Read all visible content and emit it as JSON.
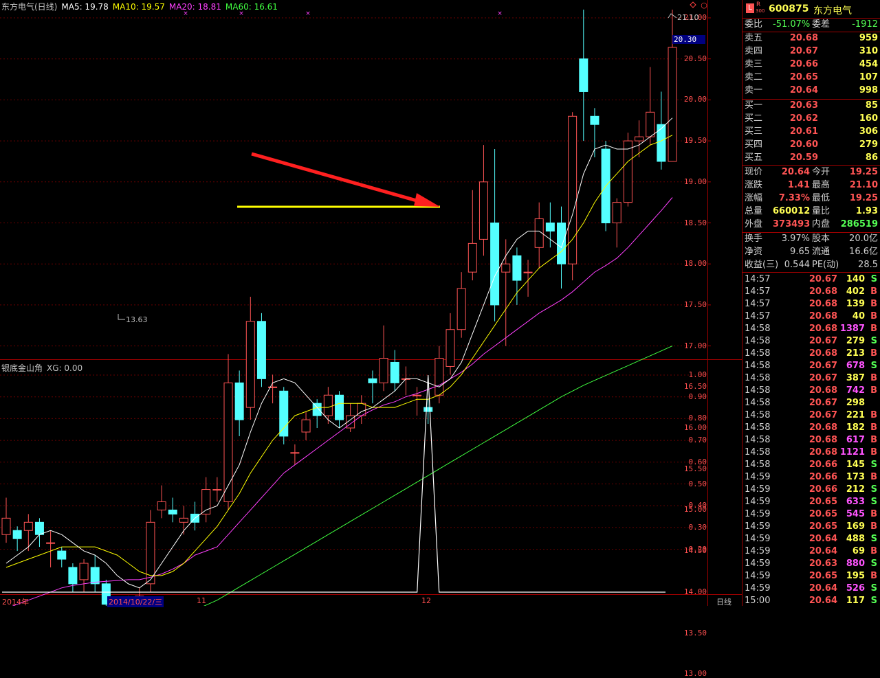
{
  "legend": {
    "title": "东方电气(日线)",
    "ma5": "MA5: 19.78",
    "ma10": "MA10: 19.57",
    "ma20": "MA20: 18.81",
    "ma60": "MA60: 16.61",
    "colors": {
      "ma5": "#ffffff",
      "ma10": "#ffff00",
      "ma20": "#ff40ff",
      "ma60": "#40ff40",
      "up": "#ff5454",
      "down": "#54ffff"
    }
  },
  "indicator": {
    "name": "银底金山角",
    "xg": "XG: 0.00"
  },
  "price_axis": [
    "21.00",
    "20.50",
    "20.00",
    "19.50",
    "19.00",
    "18.50",
    "18.00",
    "17.50",
    "17.00",
    "16.50",
    "16.00",
    "15.50",
    "15.00",
    "14.50",
    "14.00",
    "13.50",
    "13.00"
  ],
  "current_price_tag": "20.30",
  "indicator_axis": [
    "1.00",
    "0.90",
    "0.80",
    "0.70",
    "0.60",
    "0.50",
    "0.40",
    "0.30",
    "0.20"
  ],
  "annotations": {
    "high_label": "21.10",
    "low_label": "13.63"
  },
  "x_axis": {
    "year": "2014年",
    "selected_date": "2014/10/22/三",
    "month_11": "11",
    "month_12": "12",
    "period": "日线"
  },
  "chart_data": {
    "type": "candlestick",
    "title": "东方电气(日线)",
    "ylim": [
      12.7,
      21.15
    ],
    "candles": [
      [
        14.7,
        14.9,
        15.15,
        14.6
      ],
      [
        14.75,
        14.65,
        14.8,
        14.5
      ],
      [
        14.75,
        14.85,
        14.95,
        14.5
      ],
      [
        14.85,
        14.7,
        14.9,
        14.55
      ],
      [
        14.6,
        14.6,
        14.75,
        14.3
      ],
      [
        14.5,
        14.4,
        14.55,
        14.3
      ],
      [
        14.3,
        14.1,
        14.35,
        14.0
      ],
      [
        14.15,
        14.35,
        14.4,
        14.0
      ],
      [
        14.3,
        14.1,
        14.45,
        14.0
      ],
      [
        14.1,
        13.85,
        14.15,
        13.8
      ],
      [
        13.75,
        13.75,
        13.85,
        13.63
      ],
      [
        13.9,
        13.8,
        13.95,
        13.75
      ],
      [
        13.8,
        13.95,
        14.05,
        13.75
      ],
      [
        14.1,
        14.85,
        15.0,
        14.0
      ],
      [
        15.0,
        15.1,
        15.3,
        14.9
      ],
      [
        15.0,
        14.95,
        15.15,
        14.85
      ],
      [
        14.85,
        14.9,
        15.05,
        14.7
      ],
      [
        14.95,
        14.85,
        15.1,
        14.75
      ],
      [
        14.95,
        15.25,
        15.4,
        14.85
      ],
      [
        15.25,
        15.25,
        15.4,
        15.1
      ],
      [
        15.1,
        16.55,
        16.9,
        15.0
      ],
      [
        16.55,
        16.1,
        16.7,
        15.9
      ],
      [
        16.25,
        17.3,
        17.6,
        16.1
      ],
      [
        17.3,
        16.6,
        17.4,
        16.5
      ],
      [
        16.5,
        16.5,
        16.65,
        16.3
      ],
      [
        16.45,
        15.9,
        16.5,
        15.8
      ],
      [
        15.7,
        15.7,
        15.8,
        15.55
      ],
      [
        15.95,
        16.1,
        16.2,
        15.85
      ],
      [
        16.3,
        16.15,
        16.35,
        16.0
      ],
      [
        16.15,
        16.4,
        16.5,
        16.05
      ],
      [
        16.4,
        16.1,
        16.45,
        16.0
      ],
      [
        16.0,
        16.15,
        16.3,
        15.95
      ],
      [
        16.15,
        16.3,
        16.4,
        16.05
      ],
      [
        16.6,
        16.55,
        16.7,
        16.3
      ],
      [
        16.55,
        16.85,
        17.25,
        16.45
      ],
      [
        16.8,
        16.55,
        16.95,
        16.45
      ],
      [
        16.6,
        16.6,
        16.75,
        16.4
      ],
      [
        16.4,
        16.4,
        16.5,
        16.15
      ],
      [
        16.25,
        16.2,
        16.35,
        16.05
      ],
      [
        16.4,
        16.85,
        17.0,
        16.3
      ],
      [
        16.75,
        17.2,
        17.4,
        16.65
      ],
      [
        17.2,
        17.7,
        17.9,
        17.1
      ],
      [
        17.9,
        18.25,
        18.9,
        17.8
      ],
      [
        18.3,
        19.0,
        19.45,
        18.1
      ],
      [
        18.5,
        17.5,
        19.4,
        17.3
      ],
      [
        17.9,
        18.0,
        18.3,
        17.0
      ],
      [
        18.1,
        17.8,
        18.2,
        17.5
      ],
      [
        17.9,
        17.9,
        18.05,
        17.6
      ],
      [
        18.2,
        18.55,
        18.75,
        17.95
      ],
      [
        18.5,
        18.4,
        18.75,
        18.2
      ],
      [
        18.5,
        18.0,
        18.7,
        17.7
      ],
      [
        18.0,
        19.8,
        19.85,
        17.8
      ],
      [
        20.5,
        20.1,
        21.1,
        19.5
      ],
      [
        19.8,
        19.7,
        19.9,
        19.3
      ],
      [
        19.4,
        18.5,
        19.5,
        18.4
      ],
      [
        18.5,
        18.75,
        18.8,
        18.2
      ],
      [
        18.75,
        19.5,
        19.6,
        18.7
      ],
      [
        19.5,
        19.55,
        19.75,
        19.3
      ],
      [
        19.55,
        19.85,
        20.4,
        19.45
      ],
      [
        19.7,
        19.25,
        20.1,
        19.15
      ],
      [
        19.25,
        20.64,
        21.1,
        19.25
      ]
    ],
    "ma5": [
      14.35,
      14.45,
      14.55,
      14.7,
      14.75,
      14.7,
      14.6,
      14.5,
      14.45,
      14.35,
      14.2,
      14.1,
      14.05,
      14.15,
      14.35,
      14.55,
      14.75,
      14.9,
      15.0,
      15.05,
      15.3,
      15.55,
      15.95,
      16.3,
      16.55,
      16.6,
      16.55,
      16.4,
      16.25,
      16.1,
      16.0,
      16.1,
      16.2,
      16.25,
      16.35,
      16.45,
      16.6,
      16.6,
      16.55,
      16.5,
      16.6,
      16.8,
      17.15,
      17.5,
      17.85,
      18.1,
      18.3,
      18.4,
      18.4,
      18.3,
      18.2,
      18.6,
      19.1,
      19.4,
      19.45,
      19.4,
      19.4,
      19.45,
      19.55,
      19.65,
      19.78
    ],
    "ma10": [
      14.3,
      14.35,
      14.4,
      14.45,
      14.5,
      14.55,
      14.55,
      14.55,
      14.55,
      14.5,
      14.45,
      14.35,
      14.25,
      14.2,
      14.2,
      14.25,
      14.35,
      14.5,
      14.65,
      14.8,
      15.0,
      15.2,
      15.45,
      15.65,
      15.85,
      16.0,
      16.15,
      16.2,
      16.25,
      16.25,
      16.3,
      16.3,
      16.3,
      16.25,
      16.25,
      16.25,
      16.3,
      16.35,
      16.35,
      16.4,
      16.5,
      16.65,
      16.85,
      17.05,
      17.25,
      17.45,
      17.65,
      17.8,
      17.95,
      18.05,
      18.15,
      18.3,
      18.5,
      18.75,
      18.95,
      19.1,
      19.25,
      19.35,
      19.45,
      19.5,
      19.57
    ],
    "ma20": [
      13.8,
      13.85,
      13.9,
      13.95,
      14.0,
      14.05,
      14.08,
      14.1,
      14.12,
      14.13,
      14.14,
      14.15,
      14.15,
      14.18,
      14.22,
      14.28,
      14.35,
      14.45,
      14.5,
      14.55,
      14.7,
      14.85,
      15.0,
      15.15,
      15.3,
      15.45,
      15.55,
      15.65,
      15.75,
      15.85,
      15.95,
      16.05,
      16.15,
      16.22,
      16.28,
      16.32,
      16.38,
      16.42,
      16.47,
      16.52,
      16.6,
      16.68,
      16.78,
      16.9,
      17.0,
      17.1,
      17.2,
      17.3,
      17.4,
      17.48,
      17.56,
      17.66,
      17.78,
      17.9,
      17.98,
      18.07,
      18.2,
      18.35,
      18.5,
      18.65,
      18.81
    ],
    "ma60": [
      12.95,
      13.0,
      13.05,
      13.1,
      13.15,
      13.2,
      13.25,
      13.3,
      13.34,
      13.38,
      13.42,
      13.46,
      13.5,
      13.55,
      13.6,
      13.66,
      13.72,
      13.78,
      13.84,
      13.9,
      13.98,
      14.06,
      14.14,
      14.22,
      14.3,
      14.38,
      14.46,
      14.54,
      14.62,
      14.7,
      14.78,
      14.86,
      14.94,
      15.02,
      15.1,
      15.18,
      15.26,
      15.34,
      15.42,
      15.5,
      15.58,
      15.66,
      15.74,
      15.82,
      15.9,
      15.98,
      16.06,
      16.14,
      16.22,
      16.3,
      16.38,
      16.45,
      16.52,
      16.58,
      16.64,
      16.7,
      16.76,
      16.82,
      16.88,
      16.94,
      17.0
    ],
    "indicator_xg": {
      "ylim": [
        0,
        1.0
      ],
      "spike_index": 38,
      "spike_value": 1.0,
      "other_value": 0
    }
  },
  "quote": {
    "code": "600875",
    "name": "东方电气",
    "icon_r": "R",
    "icon_sub": "300",
    "wei_bi_label": "委比",
    "wei_bi": "-51.07%",
    "wei_cha_label": "委差",
    "wei_cha": "-1912",
    "asks": [
      {
        "label": "卖五",
        "price": "20.68",
        "vol": "959"
      },
      {
        "label": "卖四",
        "price": "20.67",
        "vol": "310"
      },
      {
        "label": "卖三",
        "price": "20.66",
        "vol": "454"
      },
      {
        "label": "卖二",
        "price": "20.65",
        "vol": "107"
      },
      {
        "label": "卖一",
        "price": "20.64",
        "vol": "998"
      }
    ],
    "bids": [
      {
        "label": "买一",
        "price": "20.63",
        "vol": "85"
      },
      {
        "label": "买二",
        "price": "20.62",
        "vol": "160"
      },
      {
        "label": "买三",
        "price": "20.61",
        "vol": "306"
      },
      {
        "label": "买四",
        "price": "20.60",
        "vol": "279"
      },
      {
        "label": "买五",
        "price": "20.59",
        "vol": "86"
      }
    ],
    "stats": [
      {
        "l1": "现价",
        "v1": "20.64",
        "l2": "今开",
        "v2": "19.25"
      },
      {
        "l1": "涨跌",
        "v1": "1.41",
        "l2": "最高",
        "v2": "21.10"
      },
      {
        "l1": "涨幅",
        "v1": "7.33%",
        "l2": "最低",
        "v2": "19.25"
      },
      {
        "l1": "总量",
        "v1": "660012",
        "l2": "量比",
        "v2": "1.93"
      },
      {
        "l1": "外盘",
        "v1": "373493",
        "l2": "内盘",
        "v2": "286519"
      }
    ],
    "stats2": [
      {
        "l1": "换手",
        "v1": "3.97%",
        "l2": "股本",
        "v2": "20.0亿"
      },
      {
        "l1": "净资",
        "v1": "9.65",
        "l2": "流通",
        "v2": "16.6亿"
      },
      {
        "l1": "收益(三)",
        "v1": "0.544",
        "l2": "PE(动)",
        "v2": "28.5"
      }
    ],
    "ticks": [
      {
        "t": "14:57",
        "p": "20.67",
        "v": "140",
        "s": "S"
      },
      {
        "t": "14:57",
        "p": "20.68",
        "v": "402",
        "s": "B"
      },
      {
        "t": "14:57",
        "p": "20.68",
        "v": "139",
        "s": "B"
      },
      {
        "t": "14:57",
        "p": "20.68",
        "v": "40",
        "s": "B"
      },
      {
        "t": "14:58",
        "p": "20.68",
        "v": "1387",
        "s": "B"
      },
      {
        "t": "14:58",
        "p": "20.67",
        "v": "279",
        "s": "S"
      },
      {
        "t": "14:58",
        "p": "20.68",
        "v": "213",
        "s": "B"
      },
      {
        "t": "14:58",
        "p": "20.67",
        "v": "678",
        "s": "S"
      },
      {
        "t": "14:58",
        "p": "20.67",
        "v": "387",
        "s": "B"
      },
      {
        "t": "14:58",
        "p": "20.68",
        "v": "742",
        "s": "B"
      },
      {
        "t": "14:58",
        "p": "20.67",
        "v": "298",
        "s": ""
      },
      {
        "t": "14:58",
        "p": "20.67",
        "v": "221",
        "s": "B"
      },
      {
        "t": "14:58",
        "p": "20.68",
        "v": "182",
        "s": "B"
      },
      {
        "t": "14:58",
        "p": "20.68",
        "v": "617",
        "s": "B"
      },
      {
        "t": "14:58",
        "p": "20.68",
        "v": "1121",
        "s": "B"
      },
      {
        "t": "14:58",
        "p": "20.66",
        "v": "145",
        "s": "S"
      },
      {
        "t": "14:59",
        "p": "20.66",
        "v": "173",
        "s": "B"
      },
      {
        "t": "14:59",
        "p": "20.66",
        "v": "212",
        "s": "S"
      },
      {
        "t": "14:59",
        "p": "20.65",
        "v": "633",
        "s": "S"
      },
      {
        "t": "14:59",
        "p": "20.65",
        "v": "545",
        "s": "B"
      },
      {
        "t": "14:59",
        "p": "20.65",
        "v": "169",
        "s": "B"
      },
      {
        "t": "14:59",
        "p": "20.64",
        "v": "488",
        "s": "S"
      },
      {
        "t": "14:59",
        "p": "20.64",
        "v": "69",
        "s": "B"
      },
      {
        "t": "14:59",
        "p": "20.63",
        "v": "880",
        "s": "S"
      },
      {
        "t": "14:59",
        "p": "20.65",
        "v": "195",
        "s": "B"
      },
      {
        "t": "14:59",
        "p": "20.64",
        "v": "526",
        "s": "S"
      },
      {
        "t": "15:00",
        "p": "20.64",
        "v": "117",
        "s": "S"
      }
    ]
  }
}
